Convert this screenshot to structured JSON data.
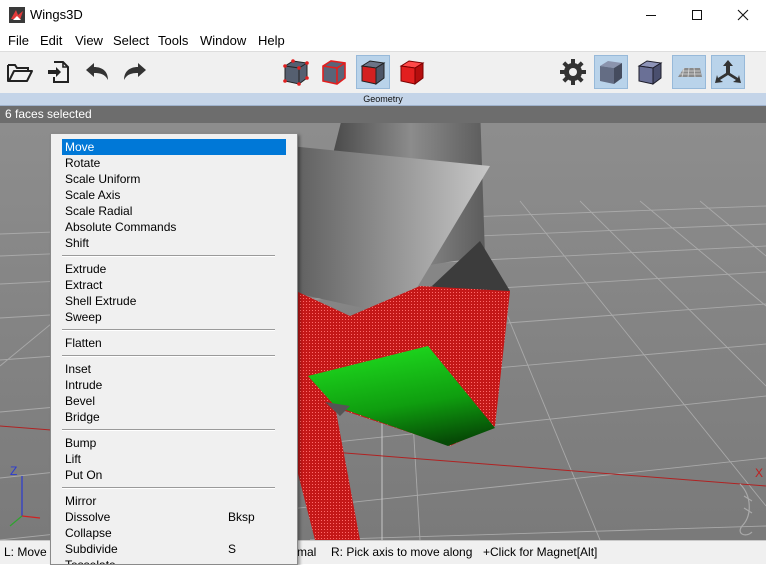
{
  "window": {
    "title": "Wings3D"
  },
  "menubar": [
    "File",
    "Edit",
    "View",
    "Select",
    "Tools",
    "Window",
    "Help"
  ],
  "toolbar": {
    "left_icons": [
      "open-folder-icon",
      "import-icon",
      "undo-icon",
      "redo-icon"
    ],
    "selection_modes": [
      "vertex-mode-icon",
      "edge-mode-icon",
      "face-mode-icon",
      "body-mode-icon"
    ],
    "active_mode": "face-mode-icon",
    "right_icons": [
      "settings-gear-icon",
      "smooth-shaded-icon",
      "wireframe-cube-icon",
      "ground-plane-icon",
      "axes-icon"
    ]
  },
  "geometry_tab": "Geometry",
  "viewport": {
    "info": "6 faces selected",
    "axis_z": "Z",
    "axis_x": "X"
  },
  "context_menu": {
    "groups": [
      [
        {
          "label": "Move",
          "highlighted": true
        },
        {
          "label": "Rotate"
        },
        {
          "label": "Scale Uniform"
        },
        {
          "label": "Scale Axis"
        },
        {
          "label": "Scale Radial"
        },
        {
          "label": "Absolute Commands"
        },
        {
          "label": "Shift"
        }
      ],
      [
        {
          "label": "Extrude"
        },
        {
          "label": "Extract"
        },
        {
          "label": "Shell Extrude"
        },
        {
          "label": "Sweep"
        }
      ],
      [
        {
          "label": "Flatten"
        }
      ],
      [
        {
          "label": "Inset"
        },
        {
          "label": "Intrude"
        },
        {
          "label": "Bevel"
        },
        {
          "label": "Bridge"
        }
      ],
      [
        {
          "label": "Bump"
        },
        {
          "label": "Lift"
        },
        {
          "label": "Put On"
        }
      ],
      [
        {
          "label": "Mirror"
        },
        {
          "label": "Dissolve",
          "shortcut": "Bksp"
        },
        {
          "label": "Collapse"
        },
        {
          "label": "Subdivide",
          "shortcut": "S"
        },
        {
          "label": "Tesselate"
        }
      ]
    ]
  },
  "statusbar": {
    "left": "L: Move a",
    "middle": "mal",
    "right1": "R: Pick axis to move along",
    "right2": "+Click for Magnet[Alt]"
  },
  "colors": {
    "selected_face": "#cc1b1b",
    "green_face": "#15c215",
    "highlight": "#0078d7",
    "active_button": "#b9d3ea"
  }
}
